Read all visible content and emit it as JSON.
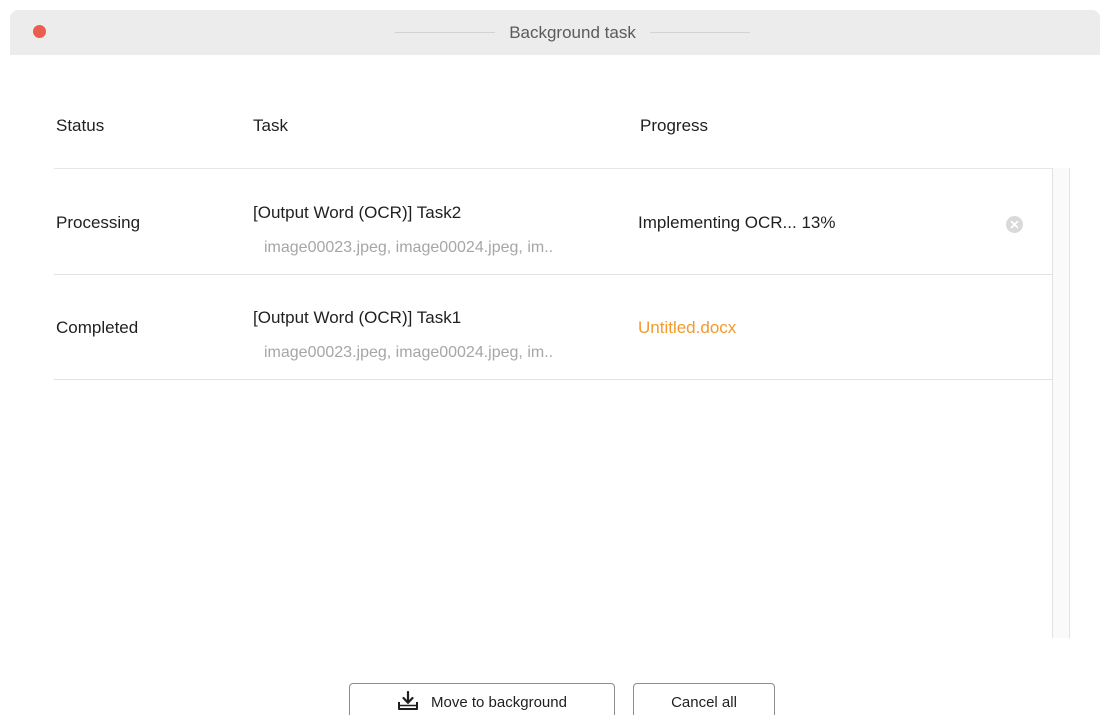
{
  "window": {
    "title": "Background task"
  },
  "table": {
    "headers": {
      "status": "Status",
      "task": "Task",
      "progress": "Progress"
    },
    "rows": [
      {
        "status": "Processing",
        "task_title": "[Output Word (OCR)] Task2",
        "task_files": "image00023.jpeg, image00024.jpeg, im..",
        "progress": "Implementing OCR... 13%",
        "has_cancel": true
      },
      {
        "status": "Completed",
        "task_title": "[Output Word (OCR)] Task1",
        "task_files": "image00023.jpeg, image00024.jpeg, im..",
        "progress": "Untitled.docx",
        "has_cancel": false
      }
    ]
  },
  "footer": {
    "move_to_background_label": "Move to background",
    "cancel_all_label": "Cancel all"
  },
  "icons": {
    "close": "close-dot-icon",
    "row_cancel": "circle-x-icon",
    "move_to_background": "download-tray-icon"
  },
  "colors": {
    "close_dot": "#ee5b4f",
    "link": "#f39a2c",
    "muted_text": "#a6a6a6",
    "titlebar": "#ececec"
  }
}
